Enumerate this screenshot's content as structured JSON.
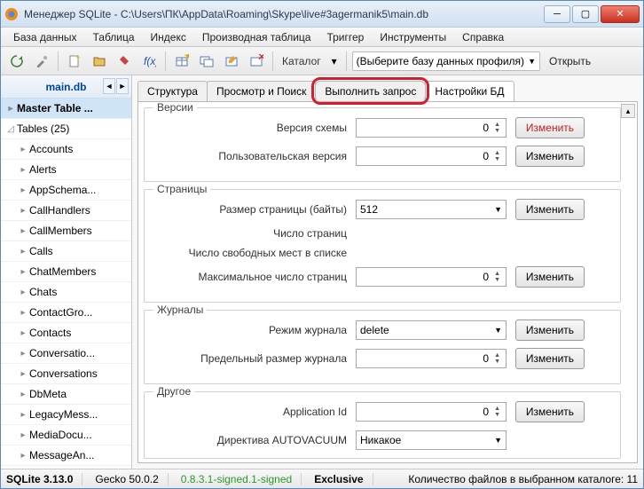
{
  "window": {
    "title": "Менеджер SQLite - C:\\Users\\ПК\\AppData\\Roaming\\Skype\\live#3agermanik5\\main.db"
  },
  "menu": {
    "items": [
      "База данных",
      "Таблица",
      "Индекс",
      "Производная таблица",
      "Триггер",
      "Инструменты",
      "Справка"
    ]
  },
  "toolbar": {
    "catalog_label": "Каталог",
    "profile_select": "(Выберите базу данных профиля)",
    "open_label": "Открыть"
  },
  "sidebar": {
    "db_name": "main.db",
    "master": "Master Table ...",
    "tables_label": "Tables (25)",
    "items": [
      "Accounts",
      "Alerts",
      "AppSchema...",
      "CallHandlers",
      "CallMembers",
      "Calls",
      "ChatMembers",
      "Chats",
      "ContactGro...",
      "Contacts",
      "Conversatio...",
      "Conversations",
      "DbMeta",
      "LegacyMess...",
      "MediaDocu...",
      "MessageAn..."
    ]
  },
  "tabs": {
    "items": [
      "Структура",
      "Просмотр и Поиск",
      "Выполнить запрос",
      "Настройки БД"
    ],
    "active_idx": 3,
    "highlight_idx": 2
  },
  "groups": {
    "versions": {
      "title": "Версии",
      "schema_label": "Версия схемы",
      "schema_val": "0",
      "user_label": "Пользовательская версия",
      "user_val": "0"
    },
    "pages": {
      "title": "Страницы",
      "size_label": "Размер страницы (байты)",
      "size_val": "512",
      "count_label": "Число страниц",
      "free_label": "Число свободных мест в списке",
      "max_label": "Максимальное число страниц",
      "max_val": "0"
    },
    "journals": {
      "title": "Журналы",
      "mode_label": "Режим журнала",
      "mode_val": "delete",
      "limit_label": "Предельный размер журнала",
      "limit_val": "0"
    },
    "other": {
      "title": "Другое",
      "appid_label": "Application Id",
      "appid_val": "0",
      "autovac_label": "Директива AUTOVACUUM",
      "autovac_val": "Никакое"
    }
  },
  "buttons": {
    "change": "Изменить"
  },
  "status": {
    "sqlite": "SQLite 3.13.0",
    "gecko": "Gecko 50.0.2",
    "signed": "0.8.3.1-signed.1-signed",
    "exclusive": "Exclusive",
    "files": "Количество файлов в выбранном каталоге: 11"
  }
}
